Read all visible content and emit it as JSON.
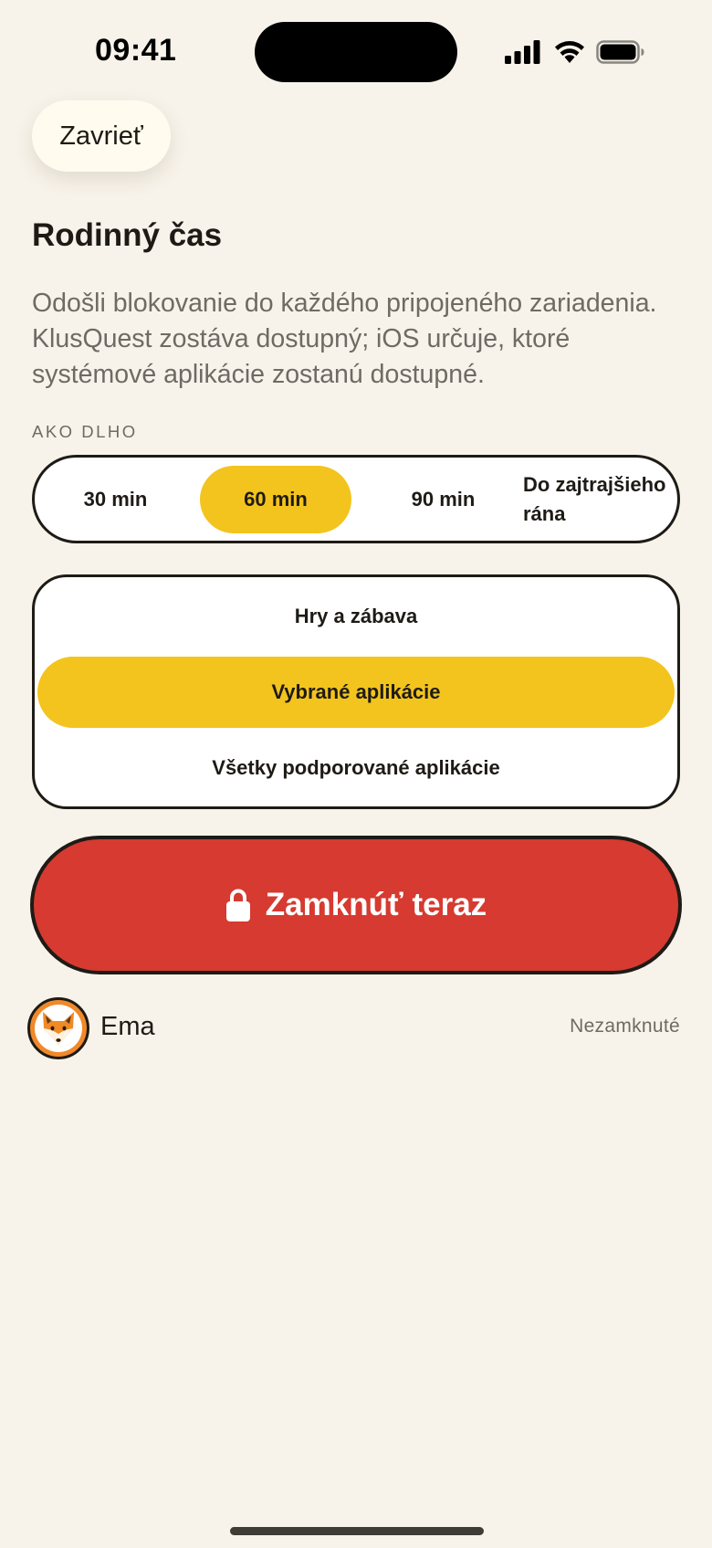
{
  "status_bar": {
    "time": "09:41"
  },
  "header": {
    "close_label": "Zavrieť",
    "title": "Rodinný čas",
    "description": "Odošli blokovanie do každého pripojeného zariadenia. KlusQuest zostáva dostupný; iOS určuje, ktoré systémové aplikácie zostanú dostupné."
  },
  "duration": {
    "label": "AKO DLHO",
    "options": [
      {
        "label": "30 min",
        "selected": false
      },
      {
        "label": "60 min",
        "selected": true
      },
      {
        "label": "90 min",
        "selected": false
      },
      {
        "label": "Do zajtrajšieho rána",
        "selected": false
      }
    ]
  },
  "categories": {
    "options": [
      {
        "label": "Hry a zábava",
        "selected": false
      },
      {
        "label": "Vybrané aplikácie",
        "selected": true
      },
      {
        "label": "Všetky podporované aplikácie",
        "selected": false
      }
    ]
  },
  "lock_action": {
    "label": "Zamknúť teraz",
    "icon": "lock-icon"
  },
  "children": [
    {
      "name": "Ema",
      "avatar": "fox-emoji",
      "status": "Nezamknuté"
    }
  ],
  "colors": {
    "background": "#F8F3EA",
    "accent_yellow": "#F3C41D",
    "lock_red": "#D63A30",
    "text": "#1E1B16",
    "muted_text": "#6E6A64"
  }
}
